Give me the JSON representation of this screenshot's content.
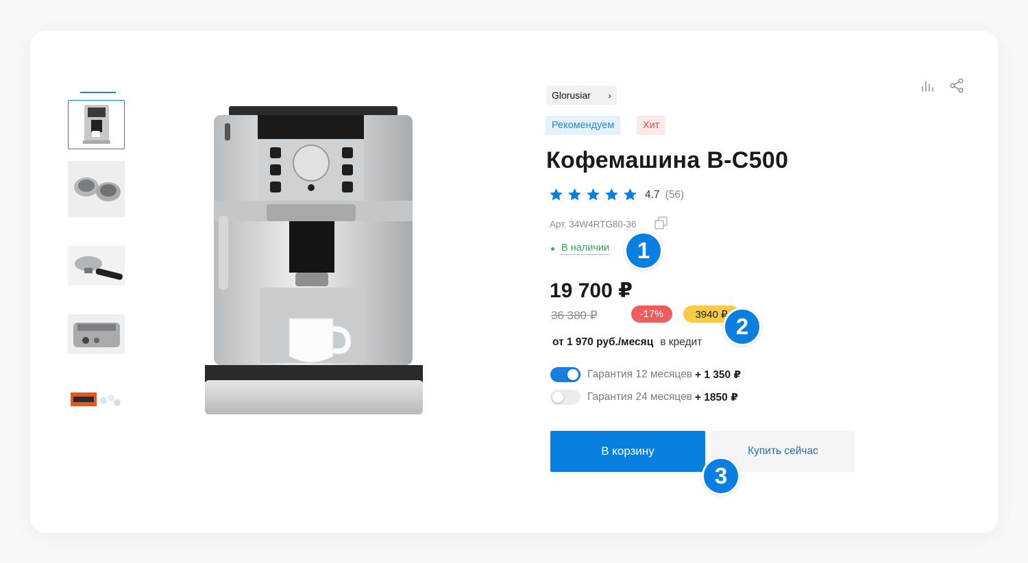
{
  "product": {
    "brand": "Glorusiar",
    "badges": {
      "recommended": "Рекомендуем",
      "hit": "Хит"
    },
    "title": "Кофемашина B-C500",
    "rating": {
      "value": "4.7",
      "count": "(56)",
      "stars": 5
    },
    "sku": "Арт. 34W4RTG80-36",
    "stock": "В наличии",
    "price": "19 700 ₽",
    "old_price": "36 380 ₽",
    "discount": "-17%",
    "savings": "3940 ₽",
    "credit": {
      "amount": "от 1 970 руб./месяц",
      "suffix": "в кредит"
    },
    "warranties": [
      {
        "label": "Гарантия 12 месяцев",
        "price": "+ 1 350 ₽",
        "enabled": true
      },
      {
        "label": "Гарантия 24 месяцев",
        "price": "+ 1850 ₽",
        "enabled": false
      }
    ]
  },
  "actions": {
    "add_to_cart": "В корзину",
    "buy_now": "Купить сейчас"
  },
  "callouts": [
    "1",
    "2",
    "3"
  ],
  "colors": {
    "accent": "#0880de",
    "stock": "#2eaa5c",
    "discount": "#ec5d5d",
    "savings": "#f7cb46"
  },
  "icons": [
    "compare-icon",
    "share-icon",
    "copy-icon",
    "star-icon",
    "chevron-right-icon"
  ]
}
